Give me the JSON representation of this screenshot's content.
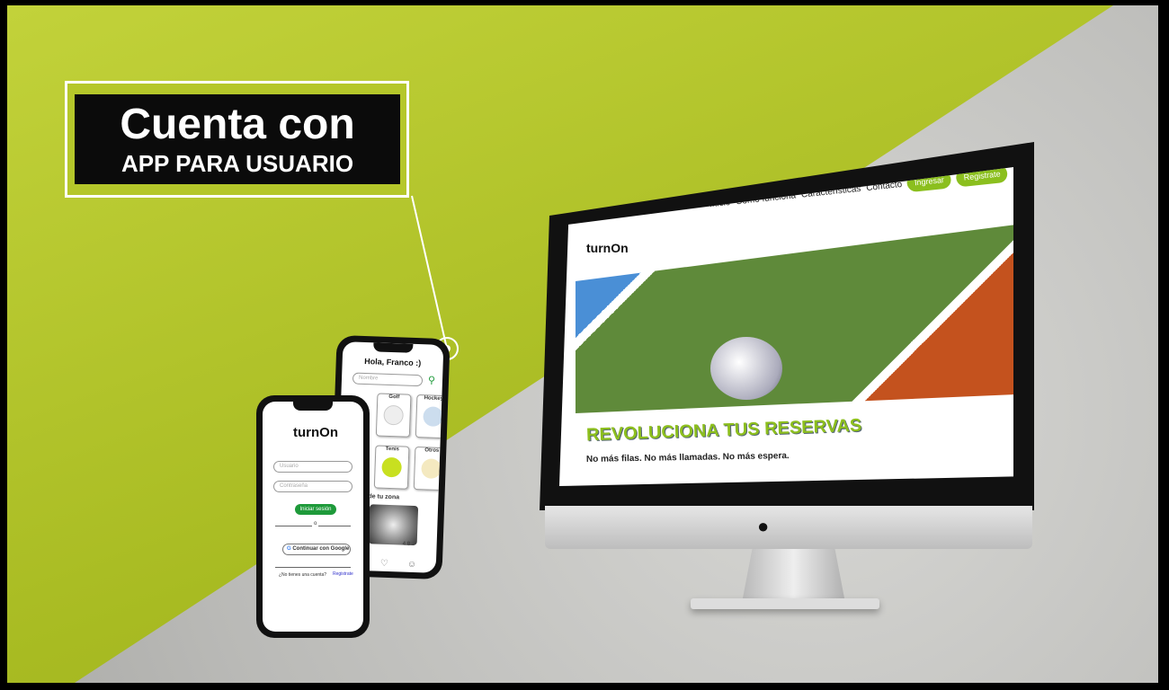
{
  "banner": {
    "line1": "Cuenta con",
    "line2": "APP PARA USUARIO"
  },
  "website": {
    "nav": [
      "Inicio",
      "Como funciona",
      "Características",
      "Contacto"
    ],
    "login_button": "Ingresar",
    "register_button": "Registrate",
    "logo": "turnOn",
    "headline": "REVOLUCIONA TUS RESERVAS",
    "subheadline": "No más filas. No más llamadas. No más espera.",
    "accent": "#8dbf1e"
  },
  "phone_login": {
    "logo": "turnOn",
    "username_placeholder": "Usuario",
    "password_placeholder": "Contraseña",
    "login_button": "Iniciar sesión",
    "divider": "o",
    "google_button": "Continuar con Google",
    "no_account": "¿No tienes una cuenta?",
    "register_link": "Registrate"
  },
  "phone_home": {
    "greeting": "Hola, Franco :)",
    "search_placeholder": "Nombre",
    "categories": [
      "Golf",
      "Hockey",
      "Tenis",
      "Otros"
    ],
    "section": "de tu zona",
    "rating": "4.8"
  }
}
